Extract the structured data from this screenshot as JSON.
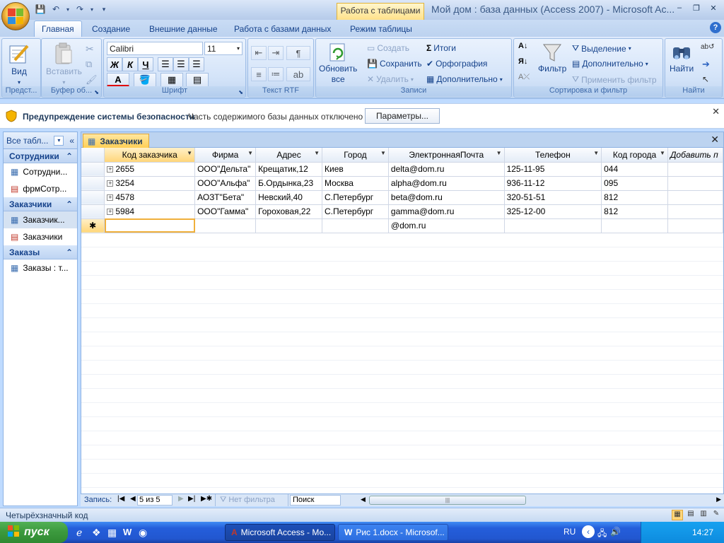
{
  "titlebar": {
    "app_title": "Мой дом : база данных (Access 2007) - Microsoft Ac...",
    "context_tab": "Работа с таблицами",
    "minimize": "‒",
    "restore": "❐",
    "close": "✕"
  },
  "ribbon_tabs": [
    "Главная",
    "Создание",
    "Внешние данные",
    "Работа с базами данных",
    "Режим таблицы"
  ],
  "ribbon": {
    "views": {
      "label": "Вид",
      "group": "Предст..."
    },
    "clipboard": {
      "paste": "Вставить",
      "group": "Буфер об..."
    },
    "font": {
      "name": "Calibri",
      "size": "11",
      "bold": "Ж",
      "italic": "К",
      "underline": "Ч",
      "font_color": "A",
      "group": "Шрифт"
    },
    "rtf": {
      "group": "Текст RTF"
    },
    "records": {
      "refresh_line1": "Обновить",
      "refresh_line2": "все",
      "new": "Создать",
      "save": "Сохранить",
      "delete": "Удалить",
      "totals": "Итоги",
      "spelling": "Орфография",
      "more": "Дополнительно",
      "group": "Записи"
    },
    "sort": {
      "filter": "Фильтр",
      "selection": "Выделение",
      "advanced": "Дополнительно",
      "apply_filter": "Применить фильтр",
      "group": "Сортировка и фильтр"
    },
    "find": {
      "find": "Найти",
      "group": "Найти"
    }
  },
  "security": {
    "title": "Предупреждение системы безопасности",
    "message": "Часть содержимого базы данных отключено",
    "button": "Параметры..."
  },
  "nav": {
    "header": "Все табл...",
    "groups": [
      {
        "label": "Сотрудники",
        "items": [
          "Сотрудни...",
          "фрмСотр..."
        ]
      },
      {
        "label": "Заказчики",
        "items": [
          "Заказчик...",
          "Заказчики"
        ]
      },
      {
        "label": "Заказы",
        "items": [
          "Заказы : т..."
        ]
      }
    ]
  },
  "document": {
    "tab": "Заказчики",
    "columns": [
      "Код заказчика",
      "Фирма",
      "Адрес",
      "Город",
      "ЭлектроннаяПочта",
      "Телефон",
      "Код города",
      "Добавить п"
    ],
    "rows": [
      [
        "2655",
        "ООО\"Дельта\"",
        "Крещатик,12",
        "Киев",
        "delta@dom.ru",
        "125-11-95",
        "044"
      ],
      [
        "3254",
        "ООО\"Альфа\"",
        "Б.Ордынка,23",
        "Москва",
        "alpha@dom.ru",
        "936-11-12",
        "095"
      ],
      [
        "4578",
        "АОЗТ\"Бета\"",
        "Невский,40",
        "С.Петербург",
        "beta@dom.ru",
        "320-51-51",
        "812"
      ],
      [
        "5984",
        "ООО\"Гамма\"",
        "Гороховая,22",
        "С.Петербург",
        "gamma@dom.ru",
        "325-12-00",
        "812"
      ]
    ],
    "new_row_email": "@dom.ru"
  },
  "record_nav": {
    "label": "Запись:",
    "position": "5 из 5",
    "no_filter": "Нет фильтра",
    "search": "Поиск"
  },
  "status": {
    "text": "Четырёхзначный код"
  },
  "taskbar": {
    "start": "пуск",
    "tasks": [
      "Microsoft Access - Мо...",
      "Рис 1.docx - Microsof..."
    ],
    "lang": "RU",
    "time": "14:27"
  }
}
